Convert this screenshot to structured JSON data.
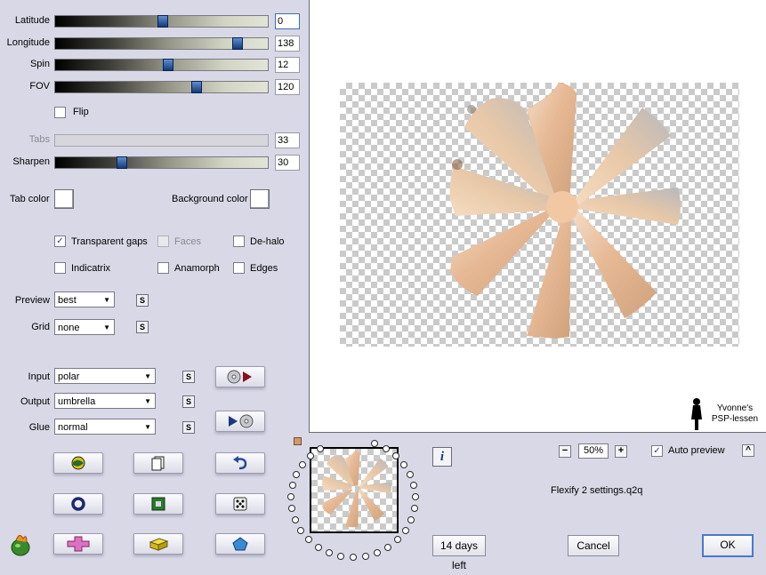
{
  "sliders": [
    {
      "label": "Latitude",
      "value": "0",
      "fraction": 0.5,
      "enabled": true,
      "focused": true
    },
    {
      "label": "Longitude",
      "value": "138",
      "fraction": 0.87,
      "enabled": true,
      "focused": false
    },
    {
      "label": "Spin",
      "value": "12",
      "fraction": 0.53,
      "enabled": true,
      "focused": false
    },
    {
      "label": "FOV",
      "value": "120",
      "fraction": 0.67,
      "enabled": true,
      "focused": false
    },
    {
      "label": "Tabs",
      "value": "33",
      "fraction": null,
      "enabled": false,
      "focused": false
    },
    {
      "label": "Sharpen",
      "value": "30",
      "fraction": 0.3,
      "enabled": true,
      "focused": false
    }
  ],
  "flip": {
    "label": "Flip",
    "checked": false
  },
  "colors": {
    "tab_color_label": "Tab color",
    "background_color_label": "Background color",
    "tab_color": "#ffffff",
    "background_color": "#ffffff"
  },
  "options": {
    "transparent_gaps": {
      "label": "Transparent gaps",
      "checked": true
    },
    "faces": {
      "label": "Faces",
      "checked": false,
      "enabled": false
    },
    "dehalo": {
      "label": "De-halo",
      "checked": false
    },
    "indicatrix": {
      "label": "Indicatrix",
      "checked": false
    },
    "anamorph": {
      "label": "Anamorph",
      "checked": false
    },
    "edges": {
      "label": "Edges",
      "checked": false
    }
  },
  "dropdowns": {
    "preview": {
      "label": "Preview",
      "value": "best"
    },
    "grid": {
      "label": "Grid",
      "value": "none"
    },
    "input": {
      "label": "Input",
      "value": "polar"
    },
    "output": {
      "label": "Output",
      "value": "umbrella"
    },
    "glue": {
      "label": "Glue",
      "value": "normal"
    }
  },
  "lock_label": "S",
  "watermark": {
    "line1": "Yvonne's",
    "line2": "PSP-lessen"
  },
  "zoom": {
    "value": "50%",
    "minus": "−",
    "plus": "+"
  },
  "auto_preview": {
    "label": "Auto preview",
    "checked": true
  },
  "collapse_label": "^",
  "info_label": "i",
  "settings_file": "Flexify 2 settings.q2q",
  "trial_button": "14 days left",
  "cancel_button": "Cancel",
  "ok_button": "OK",
  "icons": [
    "swap-arrows-icon",
    "cd-play-icon",
    "play-cd-icon",
    "randomize-globe-icon",
    "copy-page-icon",
    "undo-arrow-icon",
    "ring-icon",
    "square-frame-icon",
    "dice-icon",
    "pink-cross-icon",
    "yellow-brick-icon",
    "blue-pentagon-icon",
    "flaming-pear-logo-icon"
  ],
  "accent_colors": {
    "slider_thumb": "#1e4a8e",
    "preview_bg": "#ffffff",
    "panel_bg": "#d8d8e6",
    "flower_tone": "#e6b894"
  }
}
